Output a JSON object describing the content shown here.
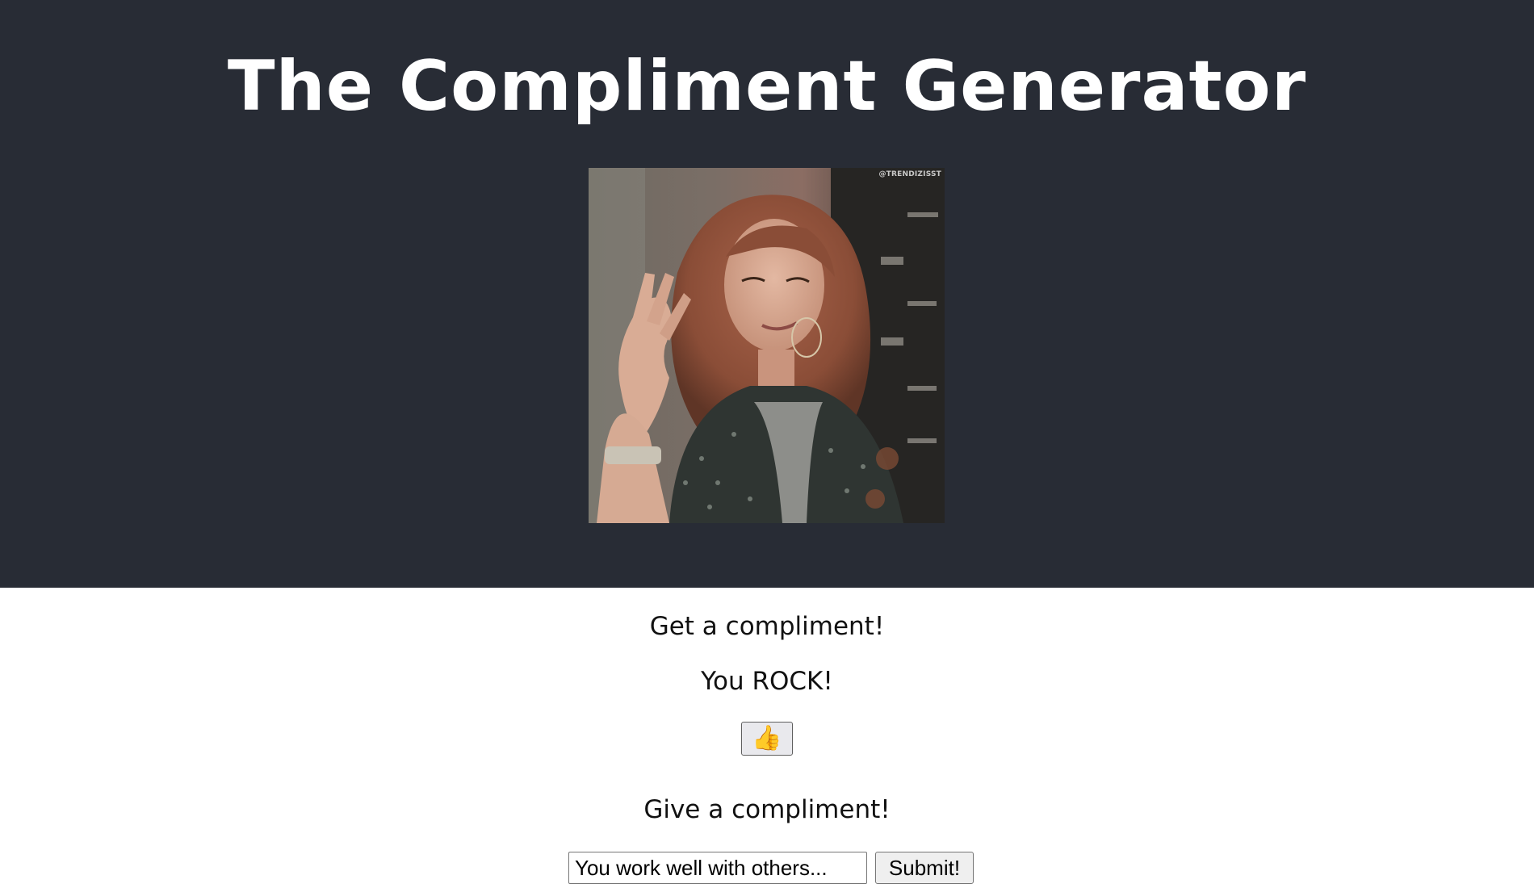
{
  "header": {
    "title": "The Compliment Generator",
    "gif_watermark": "@TRENDIZISST",
    "background_color": "#282c35"
  },
  "get_section": {
    "title": "Get a compliment!",
    "compliment_text": "You ROCK!",
    "thumb_button_label": "👍"
  },
  "give_section": {
    "title": "Give a compliment!",
    "input_value": "You work well with others...",
    "submit_label": "Submit!"
  }
}
